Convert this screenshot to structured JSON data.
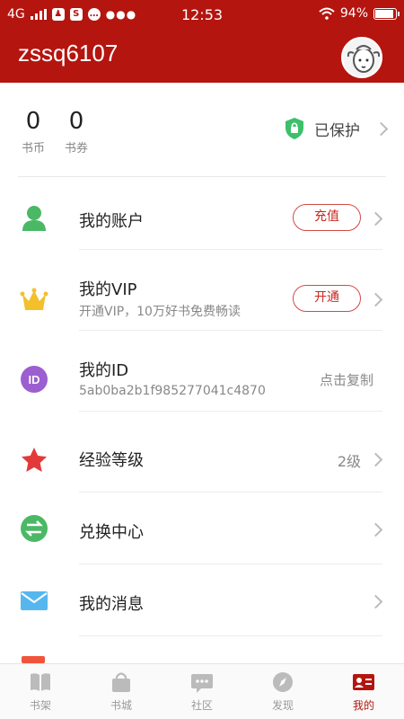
{
  "status_bar": {
    "network": "4G",
    "time": "12:53",
    "battery": "94%",
    "battery_level": 0.94
  },
  "header": {
    "username": "zssq6107"
  },
  "wallet": {
    "coins_value": "0",
    "coins_label": "书币",
    "vouchers_value": "0",
    "vouchers_label": "书券",
    "protection_status": "已保护"
  },
  "menu": {
    "account": {
      "label": "我的账户",
      "action": "充值"
    },
    "vip": {
      "label": "我的VIP",
      "subtitle": "开通VIP，10万好书免费畅读",
      "action": "开通"
    },
    "id": {
      "label": "我的ID",
      "value": "5ab0ba2b1f985277041c4870",
      "action": "点击复制"
    },
    "level": {
      "label": "经验等级",
      "value": "2级"
    },
    "exchange": {
      "label": "兑换中心"
    },
    "messages": {
      "label": "我的消息"
    }
  },
  "tabs": [
    {
      "label": "书架",
      "icon": "bookshelf-icon"
    },
    {
      "label": "书城",
      "icon": "shopping-bag-icon"
    },
    {
      "label": "社区",
      "icon": "chat-bubble-icon"
    },
    {
      "label": "发现",
      "icon": "compass-icon"
    },
    {
      "label": "我的",
      "icon": "id-card-icon",
      "active": true
    }
  ],
  "colors": {
    "brand": "#b5150f",
    "pill_border": "#d24a45",
    "shield": "#3cc06a",
    "star": "#e23a3a",
    "crown": "#f3c02b",
    "id_badge": "#9b5fd0",
    "exchange": "#4bb866",
    "mail": "#56b7ef"
  }
}
